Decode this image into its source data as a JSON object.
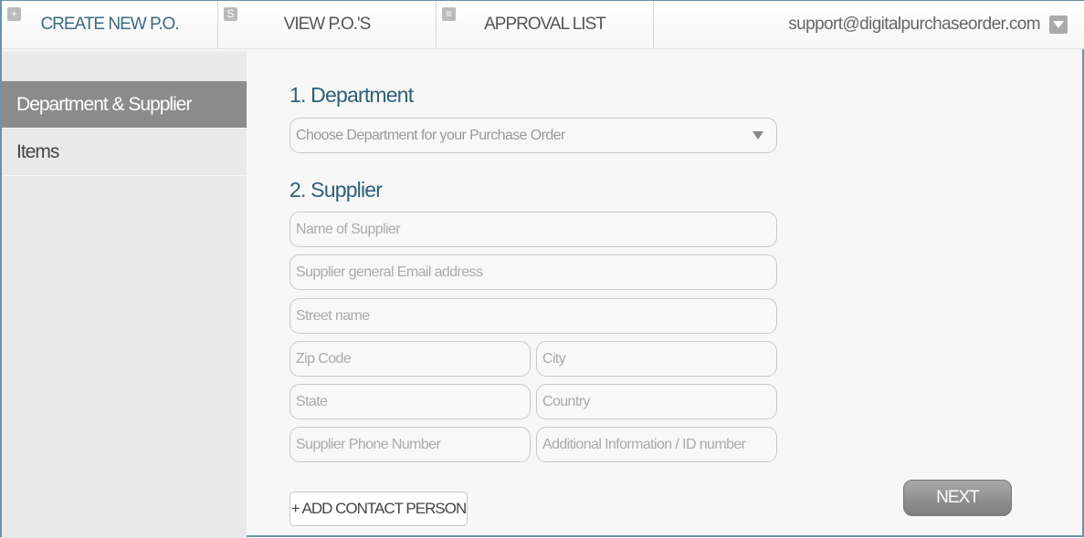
{
  "nav": {
    "tabs": [
      {
        "label": "CREATE NEW P.O.",
        "icon": "+"
      },
      {
        "label": "VIEW P.O.'S",
        "icon": "S"
      },
      {
        "label": "APPROVAL LIST",
        "icon": "≡"
      }
    ],
    "user_email": "support@digitalpurchaseorder.com"
  },
  "sidebar": {
    "items": [
      {
        "label": "Department & Supplier"
      },
      {
        "label": "Items"
      }
    ]
  },
  "form": {
    "department_heading": "1. Department",
    "department_placeholder": "Choose Department for your Purchase Order",
    "supplier_heading": "2. Supplier",
    "fields": {
      "name": "Name of Supplier",
      "email": "Supplier general Email address",
      "street": "Street name",
      "zip": "Zip Code",
      "city": "City",
      "state": "State",
      "country": "Country",
      "phone": "Supplier Phone Number",
      "additional": "Additional Information / ID number"
    },
    "add_contact": "+  ADD CONTACT PERSON",
    "next": "NEXT"
  },
  "colors": {
    "accent": "#2f5f77",
    "active_sidebar": "#8b8b8b"
  }
}
